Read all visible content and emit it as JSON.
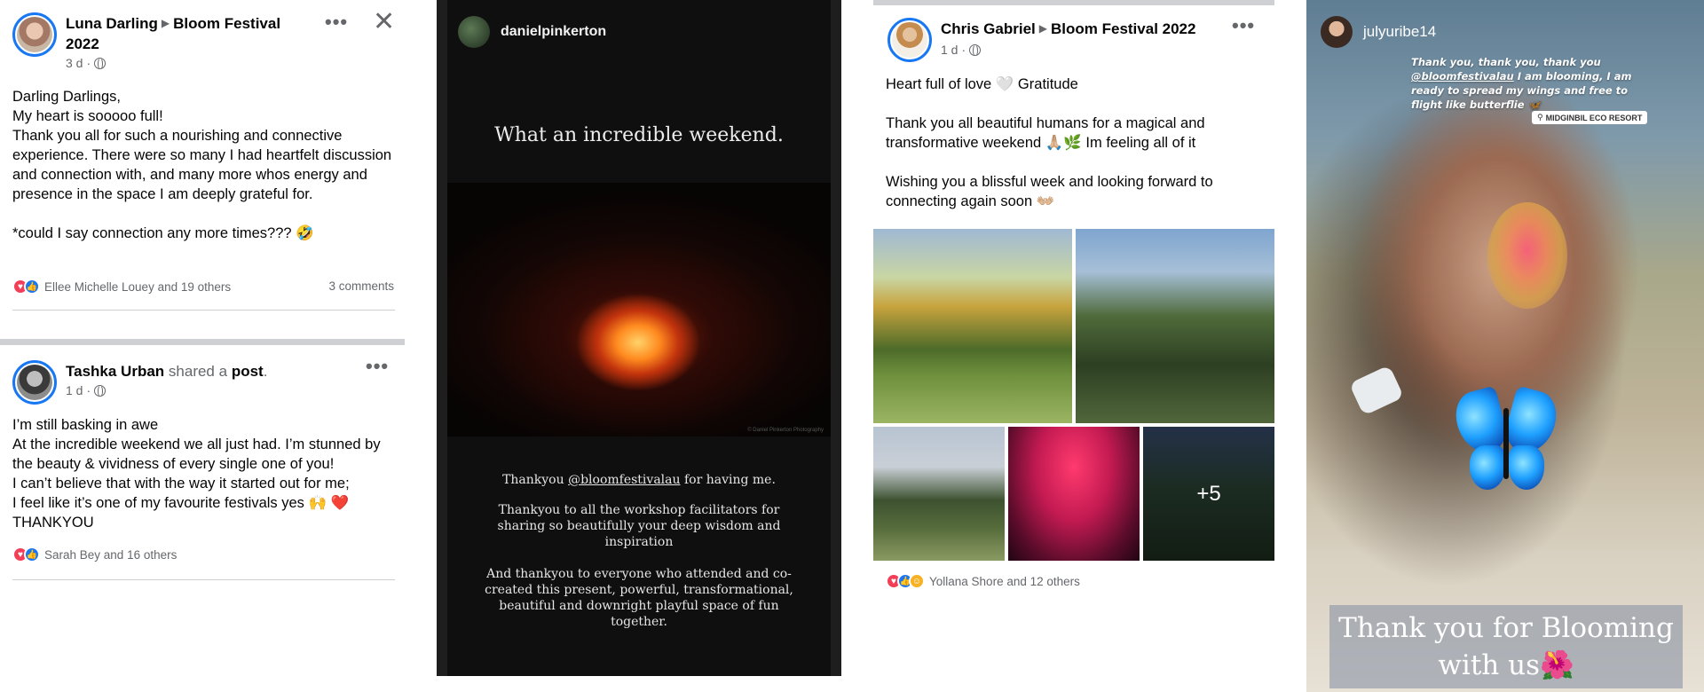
{
  "post1": {
    "author": "Luna Darling",
    "group": "Bloom Festival 2022",
    "time": "3 d",
    "body": "Darling Darlings,\nMy heart is sooooo full!\nThank you all for such a nourishing and connective experience. There were so many I had heartfelt discussion and connection with, and many more whos energy and presence in the space I am deeply grateful for.\n\n*could I say connection any more times??? 🤣",
    "reactions": "Ellee Michelle Louey and 19 others",
    "comments": "3 comments"
  },
  "post2": {
    "author": "Tashka Urban",
    "shared": "shared a",
    "post_word": "post",
    "time": "1 d",
    "body": "I’m still basking in awe\nAt the incredible weekend we all just had. I’m stunned by the beauty & vividness of every single one of you!\nI can’t believe that with the way it started out for me;\nI feel like it’s one of my favourite festivals yes 🙌 ❤️\nTHANKYOU",
    "reactions": "Sarah Bey and 16 others"
  },
  "story1": {
    "username": "danielpinkerton",
    "title": "What an incredible weekend.",
    "photo_credit": "© Daniel Pinkerton Photography",
    "line1_pre": "Thankyou ",
    "mention": "@bloomfestivalau",
    "line1_post": " for having me.",
    "para2": "Thankyou to all the workshop facilitators for sharing so beautifully your deep wisdom and inspiration",
    "para3": "And thankyou to everyone who attended and co-created this present, powerful, transformational, beautiful and downright playful space of fun together."
  },
  "post3": {
    "author": "Chris Gabriel",
    "group": "Bloom Festival 2022",
    "time": "1 d",
    "body": "Heart full of love 🤍 Gratitude\n\nThank you all beautiful humans for a magical and transformative weekend 🙏🏼🌿 Im feeling all of it\n\nWishing you a blissful week and looking forward to connecting again soon 👐🏼",
    "more_photos": "+5",
    "reactions": "Yollana Shore and 12 others"
  },
  "story2": {
    "username": "julyuribe14",
    "quote_pre": "Thank you, thank you, thank you ",
    "mention": "@bloomfestivalau",
    "quote_post": " I am blooming, I am ready to spread my wings and free to flight like butterflie 🦋",
    "location": "MIDGINBIL ECO RESORT",
    "caption": "Thank you for Blooming with us🌺"
  },
  "icons": {
    "more": "more-options-icon",
    "close": "close-icon",
    "privacy": "globe-icon",
    "like": "like-icon",
    "love": "love-icon",
    "haha": "haha-icon"
  }
}
